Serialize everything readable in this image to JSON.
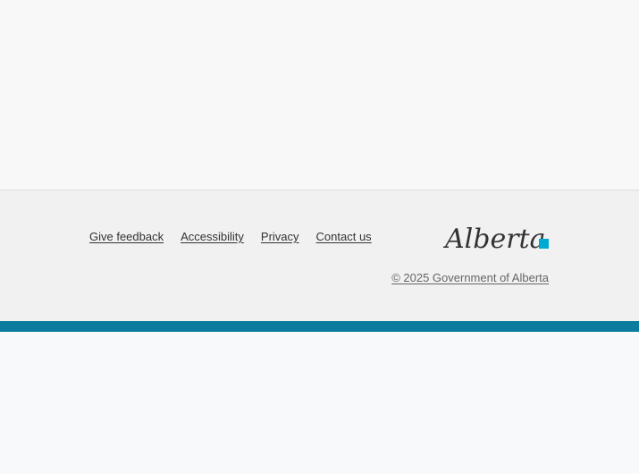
{
  "footer": {
    "links": [
      {
        "label": "Give feedback"
      },
      {
        "label": "Accessibility"
      },
      {
        "label": "Privacy"
      },
      {
        "label": "Contact us"
      }
    ],
    "logo_text": "Alberta",
    "copyright": "© 2025 Government of Alberta"
  },
  "colors": {
    "accent_bar": "#0a7d9e",
    "footer_bg": "#f1f1f1",
    "logo_square": "#00aad2",
    "logo_text": "#333333"
  },
  "icons": {
    "logo": "alberta-logo-icon"
  }
}
